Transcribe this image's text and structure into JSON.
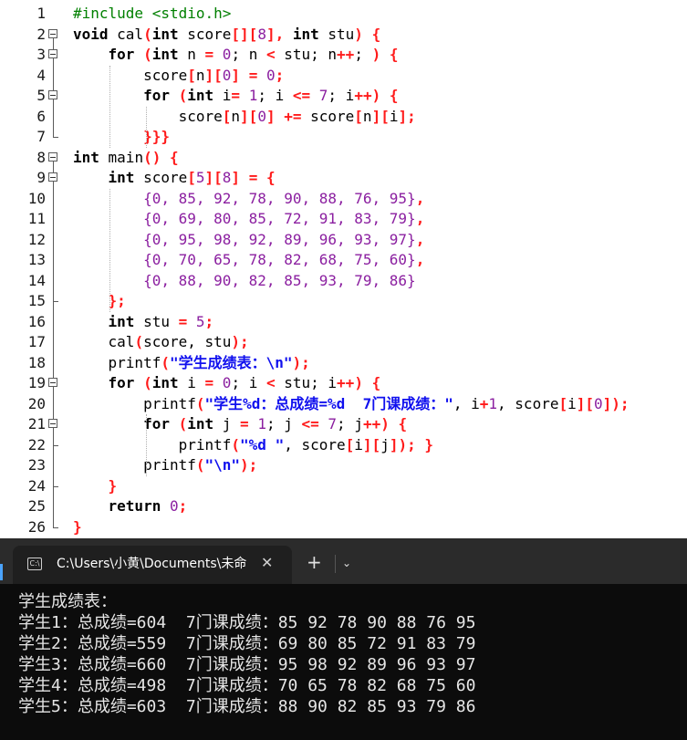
{
  "editor": {
    "lines": [
      {
        "num": "1",
        "tokens": [
          [
            "#include <stdio.h>",
            "pp"
          ]
        ]
      },
      {
        "num": "2",
        "tokens": [
          [
            "void",
            "kw"
          ],
          [
            " cal",
            "id"
          ],
          [
            "(",
            "op"
          ],
          [
            "int",
            "kw"
          ],
          [
            " score",
            "id"
          ],
          [
            "[][",
            "op"
          ],
          [
            "8",
            "num"
          ],
          [
            "],",
            "op"
          ],
          [
            " ",
            "id"
          ],
          [
            "int",
            "kw"
          ],
          [
            " stu",
            "id"
          ],
          [
            ") {",
            "op"
          ]
        ]
      },
      {
        "num": "3",
        "tokens": [
          [
            "    ",
            "id"
          ],
          [
            "for",
            "kw"
          ],
          [
            " (",
            "op"
          ],
          [
            "int",
            "kw"
          ],
          [
            " n ",
            "id"
          ],
          [
            "=",
            "op"
          ],
          [
            " ",
            "id"
          ],
          [
            "0",
            "num"
          ],
          [
            "; n ",
            "id"
          ],
          [
            "<",
            "op"
          ],
          [
            " stu; n",
            "id"
          ],
          [
            "++",
            "op"
          ],
          [
            "; ",
            "id"
          ],
          [
            ") {",
            "op"
          ]
        ]
      },
      {
        "num": "4",
        "tokens": [
          [
            "        score",
            "id"
          ],
          [
            "[",
            "op"
          ],
          [
            "n",
            "id"
          ],
          [
            "][",
            "op"
          ],
          [
            "0",
            "num"
          ],
          [
            "] =",
            "op"
          ],
          [
            " ",
            "id"
          ],
          [
            "0",
            "num"
          ],
          [
            ";",
            "op"
          ]
        ]
      },
      {
        "num": "5",
        "tokens": [
          [
            "        ",
            "id"
          ],
          [
            "for",
            "kw"
          ],
          [
            " (",
            "op"
          ],
          [
            "int",
            "kw"
          ],
          [
            " i",
            "id"
          ],
          [
            "=",
            "op"
          ],
          [
            " ",
            "id"
          ],
          [
            "1",
            "num"
          ],
          [
            "; i ",
            "id"
          ],
          [
            "<=",
            "op"
          ],
          [
            " ",
            "id"
          ],
          [
            "7",
            "num"
          ],
          [
            "; i",
            "id"
          ],
          [
            "++",
            "op"
          ],
          [
            ") {",
            "op"
          ]
        ]
      },
      {
        "num": "6",
        "tokens": [
          [
            "            score",
            "id"
          ],
          [
            "[",
            "op"
          ],
          [
            "n",
            "id"
          ],
          [
            "][",
            "op"
          ],
          [
            "0",
            "num"
          ],
          [
            "] +=",
            "op"
          ],
          [
            " score",
            "id"
          ],
          [
            "[",
            "op"
          ],
          [
            "n",
            "id"
          ],
          [
            "][",
            "op"
          ],
          [
            "i",
            "id"
          ],
          [
            "];",
            "op"
          ]
        ]
      },
      {
        "num": "7",
        "tokens": [
          [
            "        ",
            "id"
          ],
          [
            "}}}",
            "op"
          ]
        ]
      },
      {
        "num": "8",
        "tokens": [
          [
            "int",
            "kw"
          ],
          [
            " main",
            "id"
          ],
          [
            "() {",
            "op"
          ]
        ]
      },
      {
        "num": "9",
        "tokens": [
          [
            "    ",
            "id"
          ],
          [
            "int",
            "kw"
          ],
          [
            " score",
            "id"
          ],
          [
            "[",
            "op"
          ],
          [
            "5",
            "num"
          ],
          [
            "][",
            "op"
          ],
          [
            "8",
            "num"
          ],
          [
            "] = {",
            "op"
          ]
        ]
      },
      {
        "num": "10",
        "tokens": [
          [
            "        ",
            "id"
          ],
          [
            "{0, 85, 92, 78, 90, 88, 76, 95}",
            "num"
          ],
          [
            ",",
            "op"
          ]
        ]
      },
      {
        "num": "11",
        "tokens": [
          [
            "        ",
            "id"
          ],
          [
            "{0, 69, 80, 85, 72, 91, 83, 79}",
            "num"
          ],
          [
            ",",
            "op"
          ]
        ]
      },
      {
        "num": "12",
        "tokens": [
          [
            "        ",
            "id"
          ],
          [
            "{0, 95, 98, 92, 89, 96, 93, 97}",
            "num"
          ],
          [
            ",",
            "op"
          ]
        ]
      },
      {
        "num": "13",
        "tokens": [
          [
            "        ",
            "id"
          ],
          [
            "{0, 70, 65, 78, 82, 68, 75, 60}",
            "num"
          ],
          [
            ",",
            "op"
          ]
        ]
      },
      {
        "num": "14",
        "tokens": [
          [
            "        ",
            "id"
          ],
          [
            "{0, 88, 90, 82, 85, 93, 79, 86}",
            "num"
          ]
        ]
      },
      {
        "num": "15",
        "tokens": [
          [
            "    ",
            "id"
          ],
          [
            "};",
            "op"
          ]
        ]
      },
      {
        "num": "16",
        "tokens": [
          [
            "    ",
            "id"
          ],
          [
            "int",
            "kw"
          ],
          [
            " stu ",
            "id"
          ],
          [
            "=",
            "op"
          ],
          [
            " ",
            "id"
          ],
          [
            "5",
            "num"
          ],
          [
            ";",
            "op"
          ]
        ]
      },
      {
        "num": "17",
        "tokens": [
          [
            "    cal",
            "id"
          ],
          [
            "(",
            "op"
          ],
          [
            "score, stu",
            "id"
          ],
          [
            ");",
            "op"
          ]
        ]
      },
      {
        "num": "18",
        "tokens": [
          [
            "    printf",
            "id"
          ],
          [
            "(",
            "op"
          ],
          [
            "\"学生成绩表：\\n\"",
            "str"
          ],
          [
            ");",
            "op"
          ]
        ]
      },
      {
        "num": "19",
        "tokens": [
          [
            "    ",
            "id"
          ],
          [
            "for",
            "kw"
          ],
          [
            " (",
            "op"
          ],
          [
            "int",
            "kw"
          ],
          [
            " i ",
            "id"
          ],
          [
            "=",
            "op"
          ],
          [
            " ",
            "id"
          ],
          [
            "0",
            "num"
          ],
          [
            "; i ",
            "id"
          ],
          [
            "<",
            "op"
          ],
          [
            " stu; i",
            "id"
          ],
          [
            "++",
            "op"
          ],
          [
            ") {",
            "op"
          ]
        ]
      },
      {
        "num": "20",
        "tokens": [
          [
            "        printf",
            "id"
          ],
          [
            "(",
            "op"
          ],
          [
            "\"学生%d：总成绩=%d  7门课成绩：\"",
            "str"
          ],
          [
            ", i",
            "id"
          ],
          [
            "+",
            "op"
          ],
          [
            "1",
            "num"
          ],
          [
            ", score",
            "id"
          ],
          [
            "[",
            "op"
          ],
          [
            "i",
            "id"
          ],
          [
            "][",
            "op"
          ],
          [
            "0",
            "num"
          ],
          [
            "]);",
            "op"
          ]
        ]
      },
      {
        "num": "21",
        "tokens": [
          [
            "        ",
            "id"
          ],
          [
            "for",
            "kw"
          ],
          [
            " (",
            "op"
          ],
          [
            "int",
            "kw"
          ],
          [
            " j ",
            "id"
          ],
          [
            "=",
            "op"
          ],
          [
            " ",
            "id"
          ],
          [
            "1",
            "num"
          ],
          [
            "; j ",
            "id"
          ],
          [
            "<=",
            "op"
          ],
          [
            " ",
            "id"
          ],
          [
            "7",
            "num"
          ],
          [
            "; j",
            "id"
          ],
          [
            "++",
            "op"
          ],
          [
            ") {",
            "op"
          ]
        ]
      },
      {
        "num": "22",
        "tokens": [
          [
            "            printf",
            "id"
          ],
          [
            "(",
            "op"
          ],
          [
            "\"%d \"",
            "str"
          ],
          [
            ", score",
            "id"
          ],
          [
            "[",
            "op"
          ],
          [
            "i",
            "id"
          ],
          [
            "][",
            "op"
          ],
          [
            "j",
            "id"
          ],
          [
            "]); }",
            "op"
          ]
        ]
      },
      {
        "num": "23",
        "tokens": [
          [
            "        printf",
            "id"
          ],
          [
            "(",
            "op"
          ],
          [
            "\"\\n\"",
            "str"
          ],
          [
            ");",
            "op"
          ]
        ]
      },
      {
        "num": "24",
        "tokens": [
          [
            "    ",
            "id"
          ],
          [
            "}",
            "op"
          ]
        ]
      },
      {
        "num": "25",
        "tokens": [
          [
            "    ",
            "id"
          ],
          [
            "return",
            "kw"
          ],
          [
            " ",
            "id"
          ],
          [
            "0",
            "num"
          ],
          [
            ";",
            "op"
          ]
        ]
      },
      {
        "num": "26",
        "tokens": [
          [
            "}",
            "op"
          ]
        ]
      }
    ]
  },
  "colors": {
    "kw": "#000000",
    "id": "#000000",
    "op": "#ff1a1a",
    "num": "#8b1fa0",
    "str": "#1010ee",
    "pp": "#008000"
  },
  "terminal": {
    "tab_title": "C:\\Users\\小黄\\Documents\\未命",
    "tab_icon": "cmd-icon",
    "close_glyph": "✕",
    "new_tab_glyph": "+",
    "dropdown_glyph": "⌄",
    "output": [
      "学生成绩表：",
      "学生1：总成绩=604  7门课成绩：85 92 78 90 88 76 95",
      "学生2：总成绩=559  7门课成绩：69 80 85 72 91 83 79",
      "学生3：总成绩=660  7门课成绩：95 98 92 89 96 93 97",
      "学生4：总成绩=498  7门课成绩：70 65 78 82 68 75 60",
      "学生5：总成绩=603  7门课成绩：88 90 82 85 93 79 86"
    ]
  }
}
